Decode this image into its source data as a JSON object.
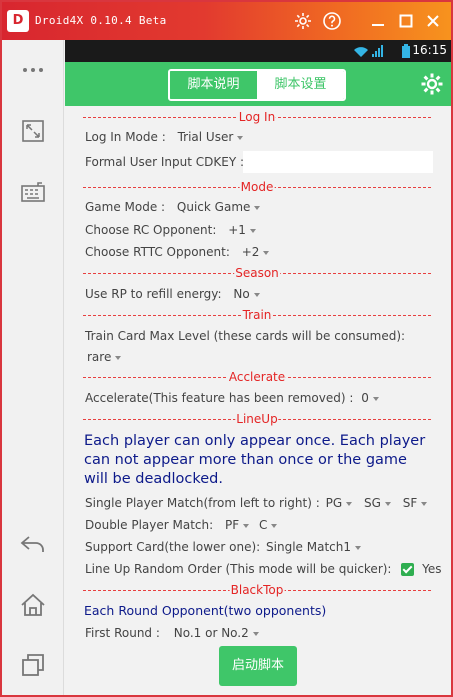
{
  "window": {
    "logo_text": "D",
    "title": "Droid4X 0.10.4 Beta"
  },
  "titlebar_icons": [
    "gear-icon",
    "help-icon",
    "minimize-icon",
    "maximize-icon",
    "close-icon"
  ],
  "sidebar_icons": [
    "more-icon",
    "fullscreen-icon",
    "keyboard-icon",
    "back-icon",
    "home-icon",
    "recent-apps-icon"
  ],
  "statusbar": {
    "time": "16:15"
  },
  "header": {
    "tabs": [
      "脚本说明",
      "脚本设置"
    ],
    "active_tab": 1
  },
  "sections": {
    "login": "Log In",
    "mode": "Mode",
    "season": "Season",
    "train": "Train",
    "acclerate": "Acclerate",
    "lineup": "LineUp",
    "blacktop": "BlackTop"
  },
  "login": {
    "mode_label": "Log In Mode :",
    "mode_value": "Trial User",
    "cdkey_label": "Formal User Input CDKEY :",
    "cdkey_value": ""
  },
  "mode": {
    "game_mode_label": "Game Mode :",
    "game_mode_value": "Quick Game",
    "rc_label": "Choose RC  Opponent:",
    "rc_value": "+1",
    "rttc_label": "Choose RTTC  Opponent:",
    "rttc_value": "+2"
  },
  "season": {
    "rp_label": "Use RP to refill energy:",
    "rp_value": "No"
  },
  "train": {
    "max_level_label": "Train Card Max Level (these cards will be consumed):",
    "max_level_value": "rare"
  },
  "accelerate": {
    "label": "Accelerate(This feature has been removed) :",
    "value": "0"
  },
  "lineup": {
    "notice": "Each player can only appear once. Each player can not appear more than once or the game will be deadlocked.",
    "single_label": "Single Player Match(from left to right) :",
    "single_values": [
      "PG",
      "SG",
      "SF"
    ],
    "double_label": "Double Player Match:",
    "double_values": [
      "PF",
      "C"
    ],
    "support_label": "Support Card(the lower one):",
    "support_value": "Single Match1",
    "random_label": "Line Up Random Order (This mode will be quicker):",
    "random_value": "Yes"
  },
  "blacktop": {
    "each_round_label": "Each Round Opponent(two opponents)",
    "first_round_label": "First Round :",
    "first_round_value": "No.1 or No.2"
  },
  "start_button": "启动脚本",
  "colors": {
    "accent_green": "#3fc669",
    "section_red": "#e42525",
    "notice_blue": "#0d1a8a",
    "titlebar_start": "#d8262f",
    "titlebar_end": "#f7931e"
  }
}
